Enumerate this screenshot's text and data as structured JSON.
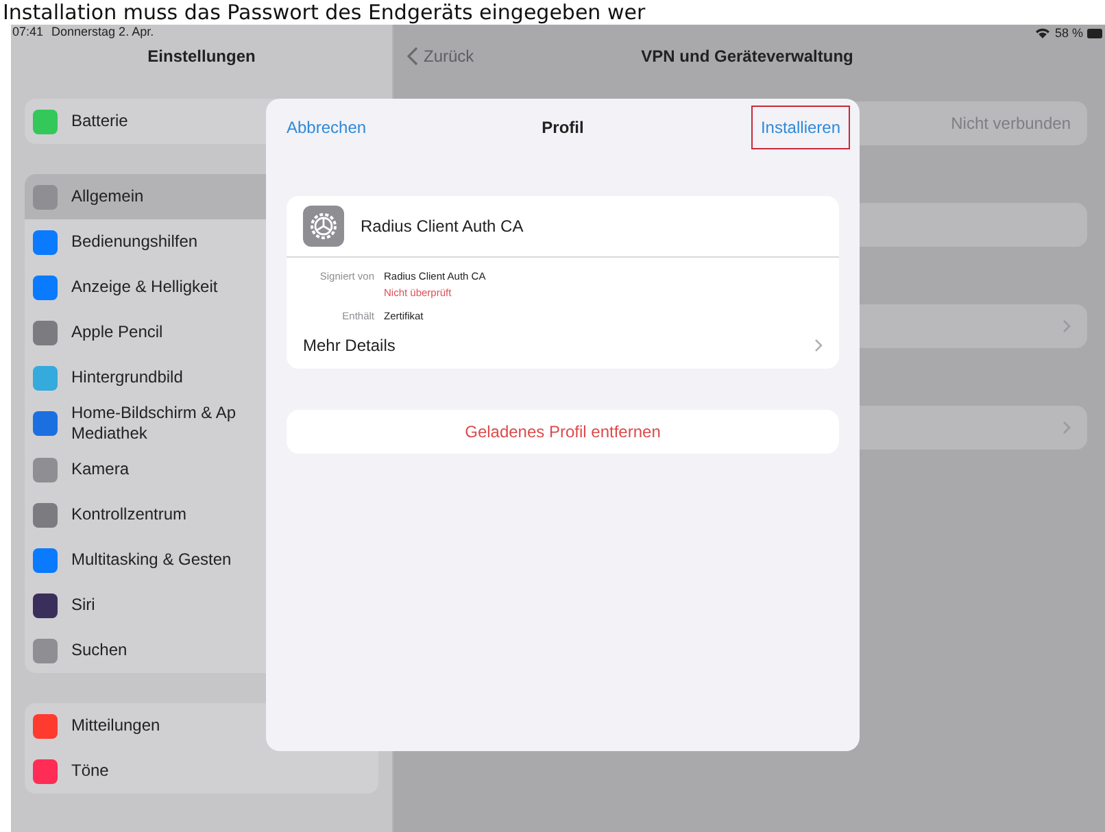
{
  "caption": "Installation muss das Passwort des Endgeräts eingegeben wer",
  "status_bar": {
    "time": "07:41",
    "date": "Donnerstag 2. Apr.",
    "battery": "58 %"
  },
  "sidebar": {
    "title": "Einstellungen",
    "groups": [
      {
        "items": [
          {
            "label": "Batterie",
            "color": "#34c759",
            "selected": false
          }
        ]
      },
      {
        "items": [
          {
            "label": "Allgemein",
            "color": "#8e8e93",
            "selected": true
          },
          {
            "label": "Bedienungshilfen",
            "color": "#0a7aff",
            "selected": false
          },
          {
            "label": "Anzeige & Helligkeit",
            "color": "#0a7aff",
            "selected": false
          },
          {
            "label": "Apple Pencil",
            "color": "#7c7c80",
            "selected": false
          },
          {
            "label": "Hintergrundbild",
            "color": "#35aadc",
            "selected": false
          },
          {
            "label": "Home-Bildschirm & Ap\nMediathek",
            "color": "#1c6fe0",
            "selected": false
          },
          {
            "label": "Kamera",
            "color": "#8e8e93",
            "selected": false
          },
          {
            "label": "Kontrollzentrum",
            "color": "#7c7c80",
            "selected": false
          },
          {
            "label": "Multitasking & Gesten",
            "color": "#0a7aff",
            "selected": false
          },
          {
            "label": "Siri",
            "color": "#3a2f5a",
            "selected": false
          },
          {
            "label": "Suchen",
            "color": "#8e8e93",
            "selected": false
          }
        ]
      },
      {
        "items": [
          {
            "label": "Mitteilungen",
            "color": "#ff3b30",
            "selected": false
          },
          {
            "label": "Töne",
            "color": "#ff2d55",
            "selected": false
          }
        ]
      }
    ]
  },
  "detail": {
    "back": "Zurück",
    "title": "VPN und Geräteverwaltung",
    "rows": [
      {
        "value": "Nicht verbunden",
        "chevron": false
      },
      {
        "chevron": false
      },
      {
        "chevron": true
      },
      {
        "chevron": true
      }
    ]
  },
  "modal": {
    "cancel": "Abbrechen",
    "title": "Profil",
    "install": {
      "label": "Installieren",
      "highlighted": true
    },
    "profile": {
      "name": "Radius Client Auth CA",
      "fields": [
        {
          "label": "Signiert von",
          "value": "Radius Client Auth CA",
          "note": "Nicht überprüft"
        },
        {
          "label": "Enthält",
          "value": "Zertifikat"
        }
      ],
      "more": "Mehr Details"
    },
    "remove": "Geladenes Profil entfernen"
  }
}
